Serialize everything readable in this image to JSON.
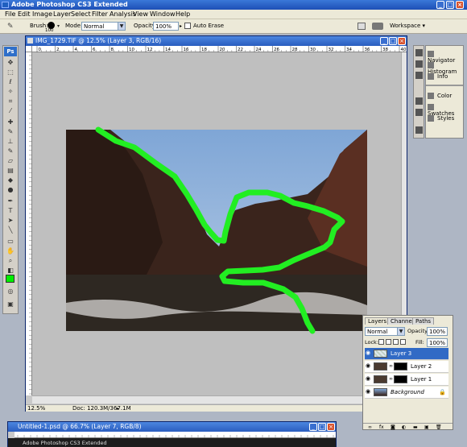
{
  "app": {
    "title": "Adobe Photoshop CS3 Extended"
  },
  "menu": [
    "File",
    "Edit",
    "Image",
    "Layer",
    "Select",
    "Filter",
    "Analysis",
    "View",
    "Window",
    "Help"
  ],
  "options": {
    "brush_label": "Brush:",
    "brush_size": "100",
    "mode_label": "Mode:",
    "mode_value": "Normal",
    "opacity_label": "Opacity:",
    "opacity_value": "100%",
    "auto_erase_label": "Auto Erase",
    "workspace_label": "Workspace"
  },
  "tools": {
    "logo": "Ps",
    "foreground_color": "#00ee00",
    "background_color": "#ffffff"
  },
  "document": {
    "title": "IMG_1729.TIF @ 12.5% (Layer 3, RGB/16)",
    "zoom": "12.5%",
    "doc_info": "Doc: 120.3M/367.1M",
    "ruler_ticks": [
      "0",
      "2",
      "4",
      "6",
      "8",
      "10",
      "12",
      "14",
      "16",
      "18",
      "20",
      "22",
      "24",
      "26",
      "28",
      "30",
      "32",
      "34",
      "36",
      "38",
      "40"
    ]
  },
  "dock": {
    "group1": [
      "Navigator",
      "Histogram",
      "Info"
    ],
    "group2": [
      "Color",
      "Swatches",
      "Styles"
    ]
  },
  "layers": {
    "tabs": [
      "Layers",
      "Channels",
      "Paths"
    ],
    "blend_mode": "Normal",
    "opacity_label": "Opacity:",
    "opacity_value": "100%",
    "lock_label": "Lock:",
    "fill_label": "Fill:",
    "fill_value": "100%",
    "items": [
      {
        "name": "Layer 3",
        "selected": true
      },
      {
        "name": "Layer 2",
        "selected": false
      },
      {
        "name": "Layer 1",
        "selected": false
      },
      {
        "name": "Background",
        "selected": false
      }
    ]
  },
  "second_document": {
    "title": "Untitled-1.psd @ 66.7% (Layer 7, RGB/8)",
    "subtitle": "Adobe Photoshop CS3 Extended"
  },
  "accent_colors": {
    "title_bar": "#2a5dbf",
    "selection": "#316ac5",
    "stroke": "#22ee22"
  }
}
